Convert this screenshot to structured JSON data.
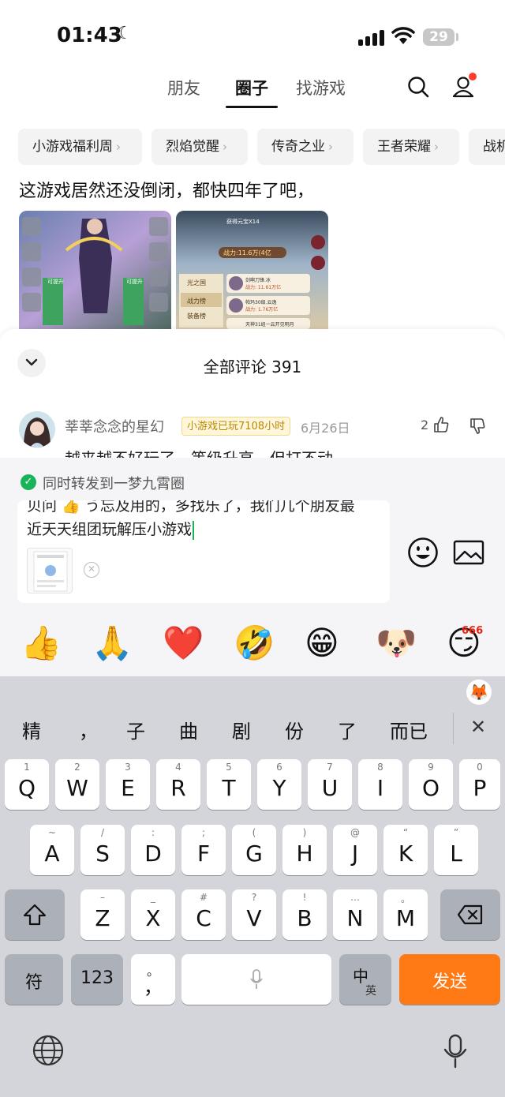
{
  "status_bar": {
    "time": "01:43",
    "battery": "29"
  },
  "tabs": [
    {
      "label": "朋友",
      "active": false
    },
    {
      "label": "圈子",
      "active": true
    },
    {
      "label": "找游戏",
      "active": false
    }
  ],
  "header_icons": [
    "search-icon",
    "profile-icon"
  ],
  "chips": [
    "小游戏福利周",
    "烈焰觉醒",
    "传奇之业",
    "王者荣耀",
    "战机"
  ],
  "post": {
    "text": "这游戏居然还没倒闭，都快四年了吧，",
    "images": [
      {
        "overlay_labels": [
          "可提升",
          "可提升"
        ]
      },
      {
        "overlay_labels": [
          "获得元宝X14",
          "战力:11.6万(4亿",
          "光之国",
          "战力榜",
          "装备榜",
          "剑啊刀锋.冰",
          "战力: 11.61万亿",
          "帕玛30级.云逸",
          "战力: 1.76万亿",
          "天神31组一云开见明月"
        ]
      }
    ]
  },
  "comments": {
    "title": "全部评论 391",
    "item": {
      "author": "莘莘念念的星幻",
      "badge": "小游戏已玩7108小时",
      "date": "6月26日",
      "likes": "2",
      "body": "越来越不好玩了，等级升高，但打不动"
    }
  },
  "composer": {
    "repost_label": "同时转发到一梦九霄圈",
    "text_line1": "贝问 👍 う忘及用的，多找乐了，我们几个朋友最",
    "text_line2": "近天天组团玩解压小游戏",
    "emojis": [
      "👍",
      "🙏",
      "❤️",
      "🤣",
      "😁",
      "🐶",
      "😏"
    ],
    "emoji_badge": "666"
  },
  "keyboard": {
    "candidates": [
      "精",
      "，",
      "子",
      "曲",
      "剧",
      "份",
      "了",
      "而已"
    ],
    "row1": [
      {
        "k": "Q",
        "s": "1"
      },
      {
        "k": "W",
        "s": "2"
      },
      {
        "k": "E",
        "s": "3"
      },
      {
        "k": "R",
        "s": "4"
      },
      {
        "k": "T",
        "s": "5"
      },
      {
        "k": "Y",
        "s": "6"
      },
      {
        "k": "U",
        "s": "7"
      },
      {
        "k": "I",
        "s": "8"
      },
      {
        "k": "O",
        "s": "9"
      },
      {
        "k": "P",
        "s": "0"
      }
    ],
    "row2": [
      {
        "k": "A",
        "s": "~"
      },
      {
        "k": "S",
        "s": "/"
      },
      {
        "k": "D",
        "s": ":"
      },
      {
        "k": "F",
        "s": ";"
      },
      {
        "k": "G",
        "s": "("
      },
      {
        "k": "H",
        "s": ")"
      },
      {
        "k": "J",
        "s": "@"
      },
      {
        "k": "K",
        "s": "“"
      },
      {
        "k": "L",
        "s": "”"
      }
    ],
    "row3": [
      {
        "k": "Z",
        "s": "–"
      },
      {
        "k": "X",
        "s": "_"
      },
      {
        "k": "C",
        "s": "#"
      },
      {
        "k": "V",
        "s": "?"
      },
      {
        "k": "B",
        "s": "!"
      },
      {
        "k": "N",
        "s": "…"
      },
      {
        "k": "M",
        "s": "。"
      }
    ],
    "symbol_key": "符",
    "number_key": "123",
    "punct_key": "，",
    "punct_key_sub": "。",
    "lang_key": "中",
    "lang_key_sub": "英",
    "send_key": "发送",
    "send_color": "#ff7a14"
  }
}
